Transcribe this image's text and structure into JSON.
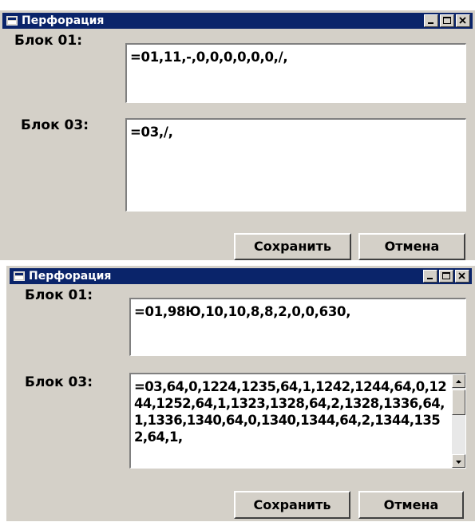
{
  "dialogs": [
    {
      "title": "Перфорация",
      "controls": {
        "minimize": "minimize",
        "maximize": "maximize",
        "close": "close"
      },
      "block01_label": "Блок 01:",
      "block01_value": "=01,11,-,0,0,0,0,0,0,/,",
      "block03_label": "Блок 03:",
      "block03_value": "=03,/,",
      "save_label": "Сохранить",
      "cancel_label": "Отмена"
    },
    {
      "title": "Перфорация",
      "controls": {
        "minimize": "minimize",
        "maximize": "maximize",
        "close": "close"
      },
      "block01_label": "Блок 01:",
      "block01_value": "=01,98Ю,10,10,8,8,2,0,0,630,",
      "block03_label": "Блок 03:",
      "block03_value": "=03,64,0,1224,1235,64,1,1242,1244,64,0,1244,1252,64,1,1323,1328,64,2,1328,1336,64,1,1336,1340,64,0,1340,1344,64,2,1344,1352,64,1,",
      "block03_scrollbar": {
        "has_up_arrow": true,
        "has_down_arrow": true
      }
    }
  ],
  "colors": {
    "titlebar": "#0a246a",
    "face": "#d4d0c8",
    "field": "#ffffff"
  },
  "icons": {
    "window_icon": "window-icon",
    "minimize": "minimize-icon",
    "maximize": "maximize-icon",
    "close": "close-icon"
  }
}
